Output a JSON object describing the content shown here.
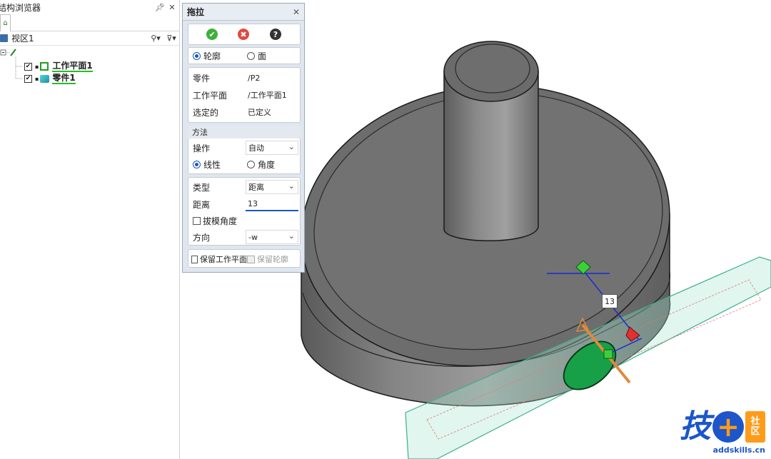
{
  "browser": {
    "title": "结构浏览器",
    "pin": "ᵖ",
    "close": "✕",
    "tab_label": "ᴙ",
    "view_label": "视区1",
    "tree": [
      {
        "label": "工作平面1",
        "checked": true
      },
      {
        "label": "零件1",
        "checked": true
      }
    ]
  },
  "dialog": {
    "title": "拖拉",
    "close": "✕",
    "actions": {
      "ok": "✔",
      "cancel": "✖",
      "help": "?"
    },
    "mode": {
      "option1": "轮廓",
      "option2": "面",
      "selected": "轮廓"
    },
    "part_label": "零件",
    "part_value": "/P2",
    "plane_label": "工作平面",
    "plane_value": "/工作平面1",
    "selected_label": "选定的",
    "selected_value": "已定义",
    "method_header": "方法",
    "operation_label": "操作",
    "operation_value": "自动",
    "linear_label": "线性",
    "angle_label": "角度",
    "type_label": "类型",
    "type_value": "距离",
    "distance_label": "距离",
    "distance_value": "13",
    "draft_label": "拔模角度",
    "direction_label": "方向",
    "direction_value": "-w",
    "keep_plane_label": "保留工作平面",
    "keep_profile_label": "保留轮廓"
  },
  "viewport": {
    "dimension_label": "13"
  },
  "watermark": {
    "char": "技",
    "plus": "+",
    "badge_top": "社",
    "badge_bottom": "区",
    "url": "addskills.cn"
  },
  "colors": {
    "accent": "#1b58b8",
    "ok": "#3bb13b",
    "cancel": "#e2483f",
    "help": "#333333",
    "plane": "#4cc7a0",
    "profile": "#18a048",
    "watermark_blue": "#1d56c9",
    "watermark_orange": "#ff9b1a"
  }
}
